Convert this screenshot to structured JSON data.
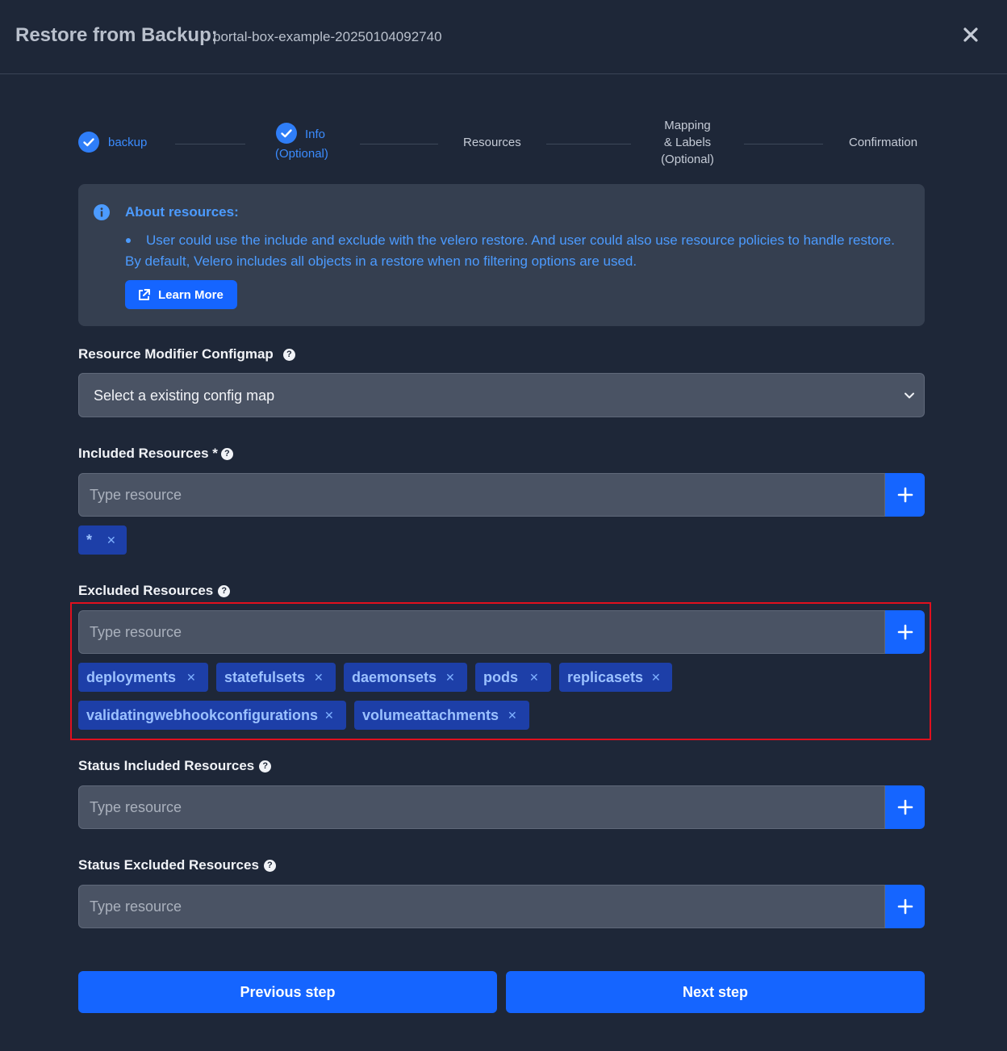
{
  "header": {
    "title": "Restore from Backup:",
    "subtitle": "portal-box-example-20250104092740"
  },
  "stepper": {
    "steps": [
      {
        "label": "backup",
        "state": "done"
      },
      {
        "label_line1": "Info",
        "label_line2": "(Optional)",
        "state": "done"
      },
      {
        "label": "Resources",
        "state": "current"
      },
      {
        "label_line1": "Mapping",
        "label_line2": "& Labels",
        "label_line3": "(Optional)",
        "state": "todo"
      },
      {
        "label": "Confirmation",
        "state": "todo"
      }
    ]
  },
  "info": {
    "title": "About resources:",
    "text": "User could use the include and exclude with the velero restore. And user could also use resource policies to handle restore. By default, Velero includes all objects in a restore when no filtering options are used.",
    "learn_more": "Learn More"
  },
  "configmap": {
    "label": "Resource Modifier Configmap",
    "selected": "Select a existing config map"
  },
  "included": {
    "label": "Included Resources *",
    "placeholder": "Type resource",
    "tags": [
      "*"
    ]
  },
  "excluded": {
    "label": "Excluded Resources",
    "placeholder": "Type resource",
    "tags": [
      "deployments",
      "statefulsets",
      "daemonsets",
      "pods",
      "replicasets",
      "validatingwebhookconfigurations",
      "volumeattachments"
    ]
  },
  "status_included": {
    "label": "Status Included Resources",
    "placeholder": "Type resource"
  },
  "status_excluded": {
    "label": "Status Excluded Resources",
    "placeholder": "Type resource"
  },
  "footer": {
    "previous": "Previous step",
    "next": "Next step"
  },
  "colors": {
    "background": "#1e2738",
    "accent": "#1565ff",
    "info_text": "#4c9bff",
    "tag_bg": "#1d3fa8",
    "highlight": "#e0101e"
  }
}
